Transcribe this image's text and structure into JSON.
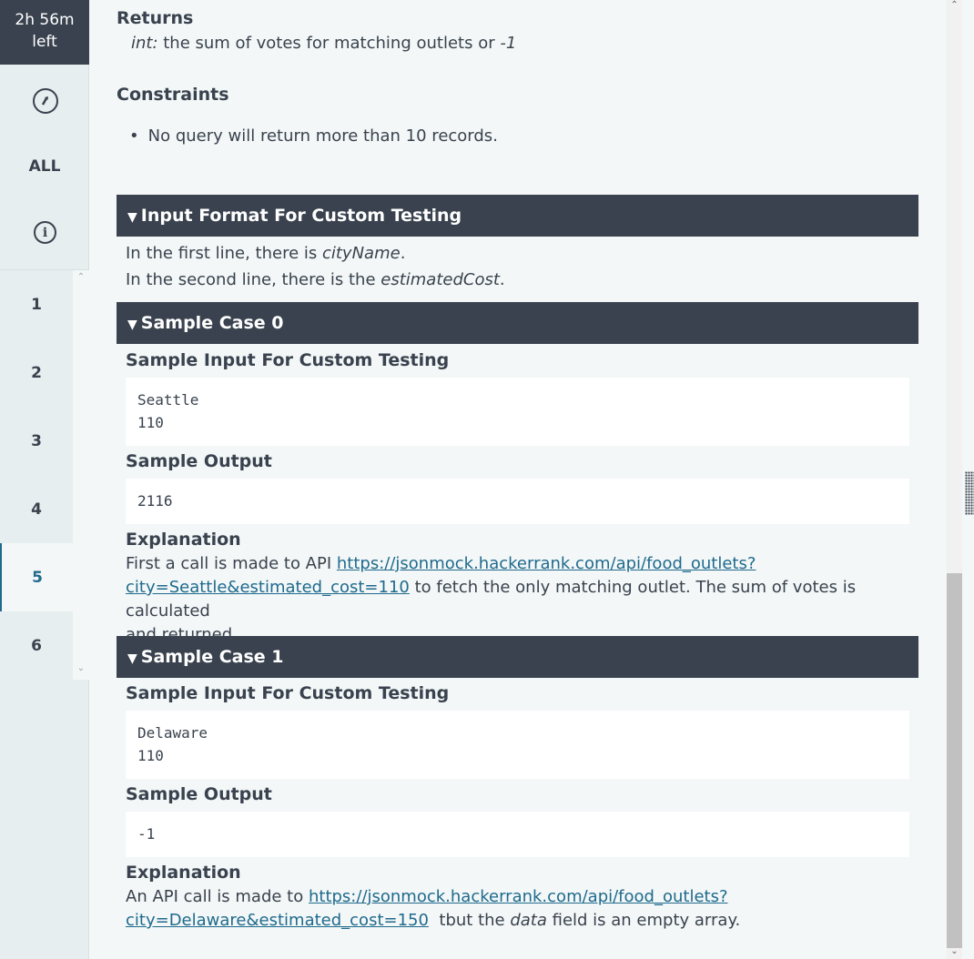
{
  "timer": {
    "line1": "2h 56m",
    "line2": "left"
  },
  "sidebar": {
    "redo_icon": "redo-icon",
    "all_label": "ALL",
    "info_icon": "info-icon",
    "questions": [
      "1",
      "2",
      "3",
      "4",
      "5",
      "6"
    ],
    "active_question": "5"
  },
  "returns": {
    "heading": "Returns",
    "type": "int:",
    "desc": " the sum of votes for matching outlets or ",
    "neg": "-1"
  },
  "constraints": {
    "heading": "Constraints",
    "item": "No query will return more than 10 records."
  },
  "input_format": {
    "bar": "Input Format For Custom Testing",
    "line1_pre": "In the first line, there is ",
    "line1_em": "cityName",
    "line1_post": ".",
    "line2_pre": "In the second line, there is the ",
    "line2_em": "estimatedCost",
    "line2_post": "."
  },
  "case0": {
    "bar": "Sample Case 0",
    "input_heading": "Sample Input For Custom Testing",
    "input_line1": "Seattle",
    "input_line2": "110",
    "output_heading": "Sample Output",
    "output": "2116",
    "expl_heading": "Explanation",
    "expl_pre": "First a call is made to API ",
    "expl_link1": "https://jsonmock.hackerrank.com/api/food_outlets?",
    "expl_link2": "city=Seattle&estimated_cost=110",
    "expl_post": " to fetch the only matching outlet. The sum of votes is calculated",
    "expl_line3": "and returned."
  },
  "case1": {
    "bar": "Sample Case 1",
    "input_heading": "Sample Input For Custom Testing",
    "input_line1": "Delaware",
    "input_line2": "110",
    "output_heading": "Sample Output",
    "output": "-1",
    "expl_heading": "Explanation",
    "expl_pre": "An API call is made to ",
    "expl_link1": "https://jsonmock.hackerrank.com/api/food_outlets?",
    "expl_link2": "city=Delaware&estimated_cost=150",
    "expl_mid": "  tbut the ",
    "expl_em": "data",
    "expl_post": " field is an empty array."
  }
}
